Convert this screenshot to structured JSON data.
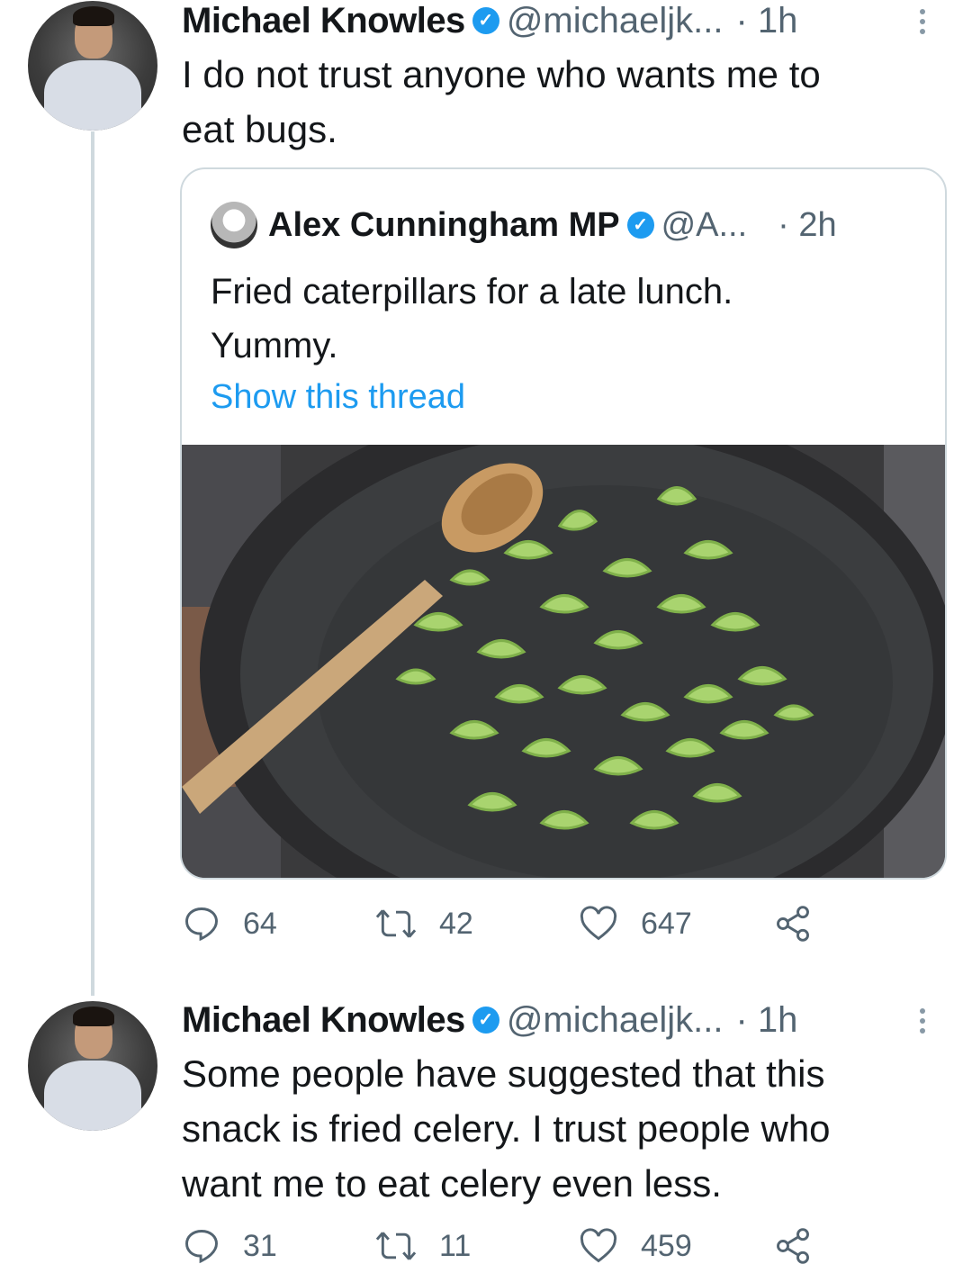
{
  "tweets": [
    {
      "name": "Michael Knowles",
      "handle": "@michaeljk...",
      "time": "· 1h",
      "text_lines": [
        "I do not trust anyone who wants me to",
        "eat bugs."
      ],
      "actions": {
        "replies": "64",
        "retweets": "42",
        "likes": "647"
      }
    },
    {
      "name": "Michael Knowles",
      "handle": "@michaeljk...",
      "time": "· 1h",
      "text_lines": [
        "Some people have suggested that this",
        "snack is fried celery. I trust people who",
        "want me to eat celery even less."
      ],
      "actions": {
        "replies": "31",
        "retweets": "11",
        "likes": "459"
      }
    }
  ],
  "quote": {
    "name": "Alex Cunningham MP",
    "handle": "@A...",
    "time": "· 2h",
    "text_lines": [
      "Fried caterpillars for a late lunch.",
      "Yummy."
    ],
    "link": "Show this thread"
  },
  "icons": {
    "verified": "verified-badge-icon",
    "reply": "reply-icon",
    "retweet": "retweet-icon",
    "like": "heart-icon",
    "share": "share-icon",
    "more": "more-vertical-icon"
  },
  "colors": {
    "verified": "#1d9bf0",
    "link": "#1d9bf0",
    "muted": "#536471",
    "thread_line": "#cfd9de"
  }
}
